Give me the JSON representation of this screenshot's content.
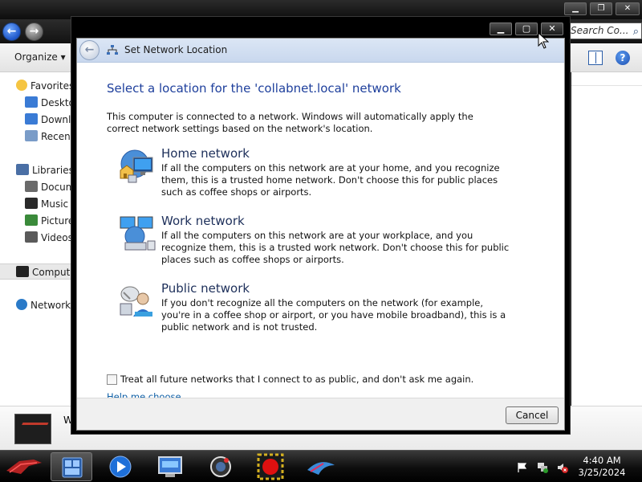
{
  "explorer": {
    "search_placeholder": "Search Co...",
    "toolbar": {
      "organize_label": "Organize ▾"
    },
    "sidebar": [
      {
        "label": "Favorites",
        "color": "#f5c542"
      },
      {
        "label": "Desktop",
        "color": "#3a7bd5"
      },
      {
        "label": "Downloads",
        "color": "#3a7bd5"
      },
      {
        "label": "Recent Places",
        "color": "#7a9cc8"
      },
      {
        "label": "Libraries",
        "color": "#4a6fa5"
      },
      {
        "label": "Documents",
        "color": "#6a6a6a"
      },
      {
        "label": "Music",
        "color": "#2a2a2a"
      },
      {
        "label": "Pictures",
        "color": "#3a8a3a"
      },
      {
        "label": "Videos",
        "color": "#5a5a5a"
      },
      {
        "label": "Computer",
        "color": "#222222"
      },
      {
        "label": "Network",
        "color": "#2a7ac8"
      }
    ],
    "details_name": "W"
  },
  "dialog": {
    "title": "Set Network Location",
    "main_instruction": "Select a location for the 'collabnet.local' network",
    "intro": "This computer is connected to a network. Windows will automatically apply the correct network settings based on the network's location.",
    "options": [
      {
        "title": "Home network",
        "description": "If all the computers on this network are at your home, and you recognize them, this is a trusted home network.  Don't choose this for public places such as coffee shops or airports."
      },
      {
        "title": "Work network",
        "description": "If all the computers on this network are at your workplace, and you recognize them, this is a trusted work network.  Don't choose this for public places such as coffee shops or airports."
      },
      {
        "title": "Public network",
        "description": "If you don't recognize all the computers on the network (for example, you're in a coffee shop or airport, or you have mobile broadband), this is a public network and is not trusted."
      }
    ],
    "checkbox_label": "Treat all future networks that I connect to as public, and don't ask me again.",
    "checkbox_checked": false,
    "help_link": "Help me choose",
    "cancel_label": "Cancel"
  },
  "taskbar": {
    "time": "4:40 AM",
    "date": "3/25/2024",
    "apps": [
      "explorer-icon",
      "media-player-icon",
      "network-center-icon",
      "camera-icon",
      "record-icon",
      "rog-app-icon"
    ]
  },
  "colors": {
    "link": "#0e5fa6",
    "instruction": "#1e3f9c",
    "header_band": "#c9d8ee"
  }
}
